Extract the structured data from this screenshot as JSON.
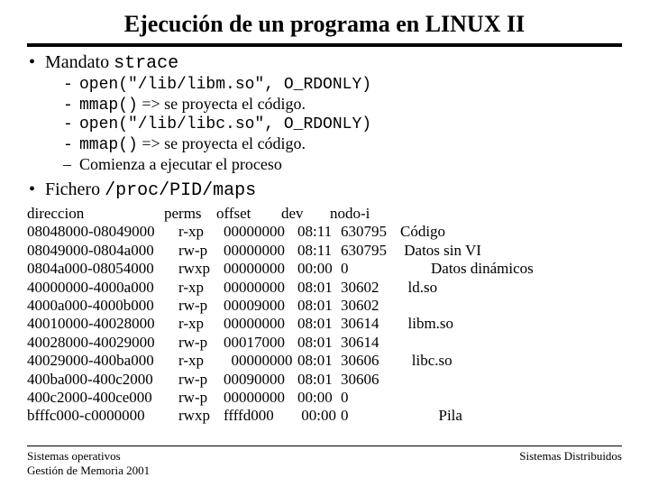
{
  "title": "Ejecución de un programa en LINUX II",
  "bullet1": {
    "lead": "Mandato ",
    "code": "strace",
    "items": [
      {
        "dash": "-",
        "text": "open(\"/lib/libm.so\", O_RDONLY)",
        "mono": true
      },
      {
        "dash": "-",
        "html": "mmap() => se proyecta el código.",
        "pre": "mmap()",
        "post": " => se proyecta el código."
      },
      {
        "dash": "-",
        "text": "open(\"/lib/libc.so\", O_RDONLY)",
        "mono": true
      },
      {
        "dash": "-",
        "html": "mmap() => se proyecta el código.",
        "pre": "mmap()",
        "post": " => se proyecta el código."
      },
      {
        "dash": "–",
        "text": "Comienza a ejecutar el proceso",
        "serif": true
      }
    ]
  },
  "bullet2": {
    "lead": "Fichero ",
    "code": "/proc/PID/maps"
  },
  "table": {
    "header": {
      "addr": "direccion",
      "perms": "perms",
      "off": "offset",
      "dev": "dev",
      "node": "nodo-i",
      "desc": ""
    },
    "rows": [
      {
        "addr": "08048000-08049000",
        "perms": "r-xp",
        "off": "00000000",
        "dev": "08:11",
        "node": "630795",
        "desc": "Código"
      },
      {
        "addr": "08049000-0804a000",
        "perms": "rw-p",
        "off": "00000000",
        "dev": "08:11",
        "node": "630795",
        "desc": " Datos sin VI"
      },
      {
        "addr": "0804a000-08054000",
        "perms": "rwxp",
        "off": "00000000",
        "dev": "00:00",
        "node": "0",
        "desc": "        Datos dinámicos"
      },
      {
        "addr": "40000000-4000a000",
        "perms": "r-xp",
        "off": "00000000",
        "dev": "08:01",
        "node": "30602",
        "desc": "  ld.so"
      },
      {
        "addr": "4000a000-4000b000",
        "perms": "rw-p",
        "off": "00009000",
        "dev": "08:01",
        "node": "30602",
        "desc": ""
      },
      {
        "addr": "40010000-40028000",
        "perms": "r-xp",
        "off": "00000000",
        "dev": "08:01",
        "node": "30614",
        "desc": "  libm.so"
      },
      {
        "addr": "40028000-40029000",
        "perms": "rw-p",
        "off": "00017000",
        "dev": "08:01",
        "node": "30614",
        "desc": ""
      },
      {
        "addr": "40029000-400ba000",
        "perms": "r-xp",
        "off": "  00000000",
        "dev": "08:01",
        "node": "30606",
        "desc": "   libc.so"
      },
      {
        "addr": "400ba000-400c2000",
        "perms": "rw-p",
        "off": "00090000",
        "dev": "08:01",
        "node": "30606",
        "desc": ""
      },
      {
        "addr": "400c2000-400ce000",
        "perms": "rw-p",
        "off": "00000000",
        "dev": "00:00",
        "node": "0",
        "desc": ""
      },
      {
        "addr": "bfffc000-c0000000",
        "perms": "rwxp",
        "off": "ffffd000",
        "dev": " 00:00",
        "node": "0",
        "desc": "          Pila"
      }
    ]
  },
  "footer": {
    "left1": "Sistemas operativos",
    "left2": "Gestión de Memoria 2001",
    "right": "Sistemas Distribuidos"
  }
}
